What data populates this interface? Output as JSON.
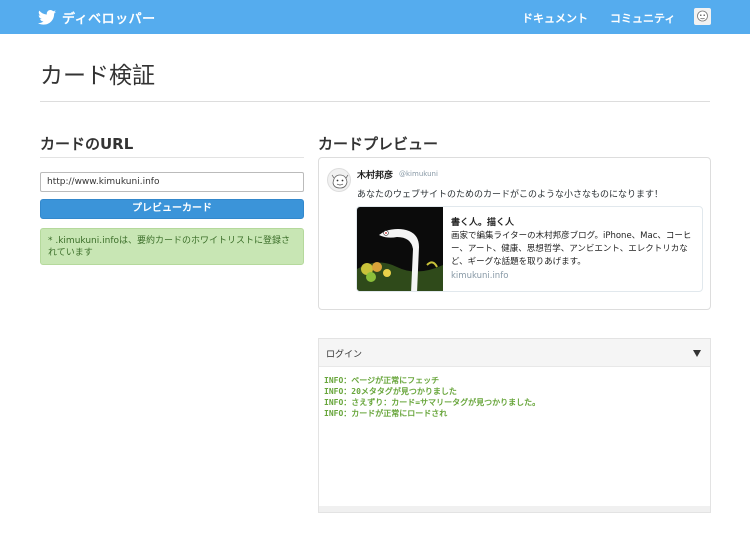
{
  "header": {
    "brand": "ディベロッパー",
    "nav": {
      "docs": "ドキュメント",
      "community": "コミュニティ"
    }
  },
  "page": {
    "title": "カード検証"
  },
  "url_section": {
    "heading": "カードのURL",
    "input_value": "http://www.kimukuni.info",
    "button_label": "プレビューカード",
    "alert": "* .kimukuni.infoは、要約カードのホワイトリストに登録されています"
  },
  "preview_section": {
    "heading": "カードプレビュー",
    "tweet": {
      "name": "木村邦彦",
      "handle": "@kimukuni",
      "text": "あなたのウェブサイトのためのカードがこのような小さなものになります！"
    },
    "card": {
      "title": "書く人。描く人",
      "description": "画家で編集ライターの木村邦彦ブログ。iPhone、Mac、コーヒー、アート、健康、思想哲学、アンビエント、エレクトリカなど、ギーグな話題を取りあげます。",
      "domain": "kimukuni.info"
    }
  },
  "log": {
    "title": "ログイン",
    "lines": [
      "INFO：ページが正常にフェッチ",
      "INFO：20メタタグが見つかりました",
      "INFO：さえずり：カード=サマリータグが見つかりました。",
      "INFO：カードが正常にロードされ"
    ]
  },
  "colors": {
    "header_bg": "#55acee",
    "button_bg": "#3b94d9",
    "alert_bg": "#c8e6b4",
    "log_text": "#67a53a"
  },
  "icons": {
    "brand": "twitter-bird-icon",
    "collapse": "caret-down-icon"
  }
}
